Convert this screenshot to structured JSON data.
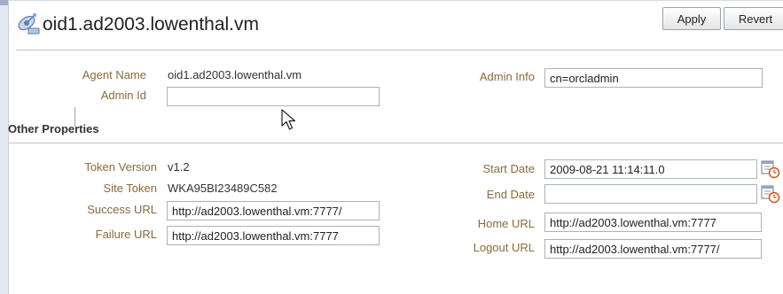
{
  "header": {
    "title": "oid1.ad2003.lowenthal.vm",
    "apply_label": "Apply",
    "revert_label": "Revert"
  },
  "general": {
    "agent_name_label": "Agent Name",
    "agent_name_value": "oid1.ad2003.lowenthal.vm",
    "admin_id_label": "Admin Id",
    "admin_id_value": "",
    "admin_info_label": "Admin Info",
    "admin_info_value": "cn=orcladmin"
  },
  "other_properties": {
    "title": "Other Properties",
    "token_version_label": "Token Version",
    "token_version_value": "v1.2",
    "site_token_label": "Site Token",
    "site_token_value": "WKA95BI23489C582",
    "success_url_label": "Success URL",
    "success_url_value": "http://ad2003.lowenthal.vm:7777/",
    "failure_url_label": "Failure URL",
    "failure_url_value": "http://ad2003.lowenthal.vm:7777",
    "start_date_label": "Start Date",
    "start_date_value": "2009-08-21 11:14:11.0",
    "end_date_label": "End Date",
    "end_date_value": "",
    "home_url_label": "Home URL",
    "home_url_value": "http://ad2003.lowenthal.vm:7777",
    "logout_url_label": "Logout URL",
    "logout_url_value": "http://ad2003.lowenthal.vm:7777/"
  },
  "icons": {
    "header": "agent-satellite-icon",
    "cursor": "mouse-pointer-icon",
    "date_picker": "calendar-clock-icon"
  },
  "colors": {
    "label": "#8a6a3a",
    "text": "#333333",
    "border": "#a9b2bc",
    "left_edge": "#e3e9f1"
  }
}
